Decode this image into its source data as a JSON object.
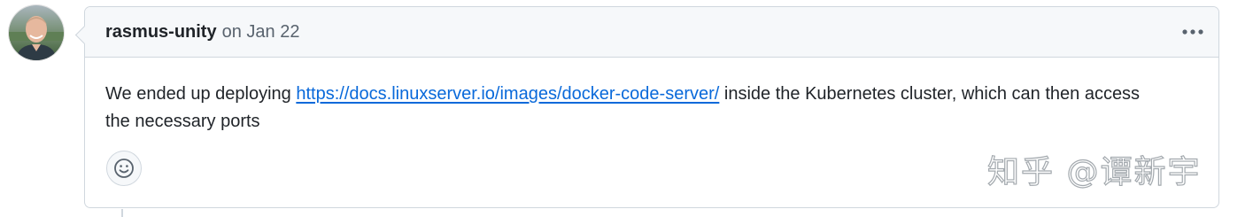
{
  "comment": {
    "author": "rasmus-unity",
    "date_text": "on Jan 22",
    "body_prefix": "We ended up deploying ",
    "link_text": "https://docs.linuxserver.io/images/docker-code-server/",
    "body_line1_suffix": " inside the Kubernetes cluster, which can then access",
    "body_line2": "the necessary ports",
    "menu_icon": "kebab-horizontal-icon",
    "reaction_icon": "smiley-icon"
  },
  "watermark": {
    "text": "知乎 @谭新宇"
  },
  "colors": {
    "link": "#0969da",
    "border": "#d0d7de",
    "header_bg": "#f6f8fa",
    "muted_text": "#59636e"
  }
}
